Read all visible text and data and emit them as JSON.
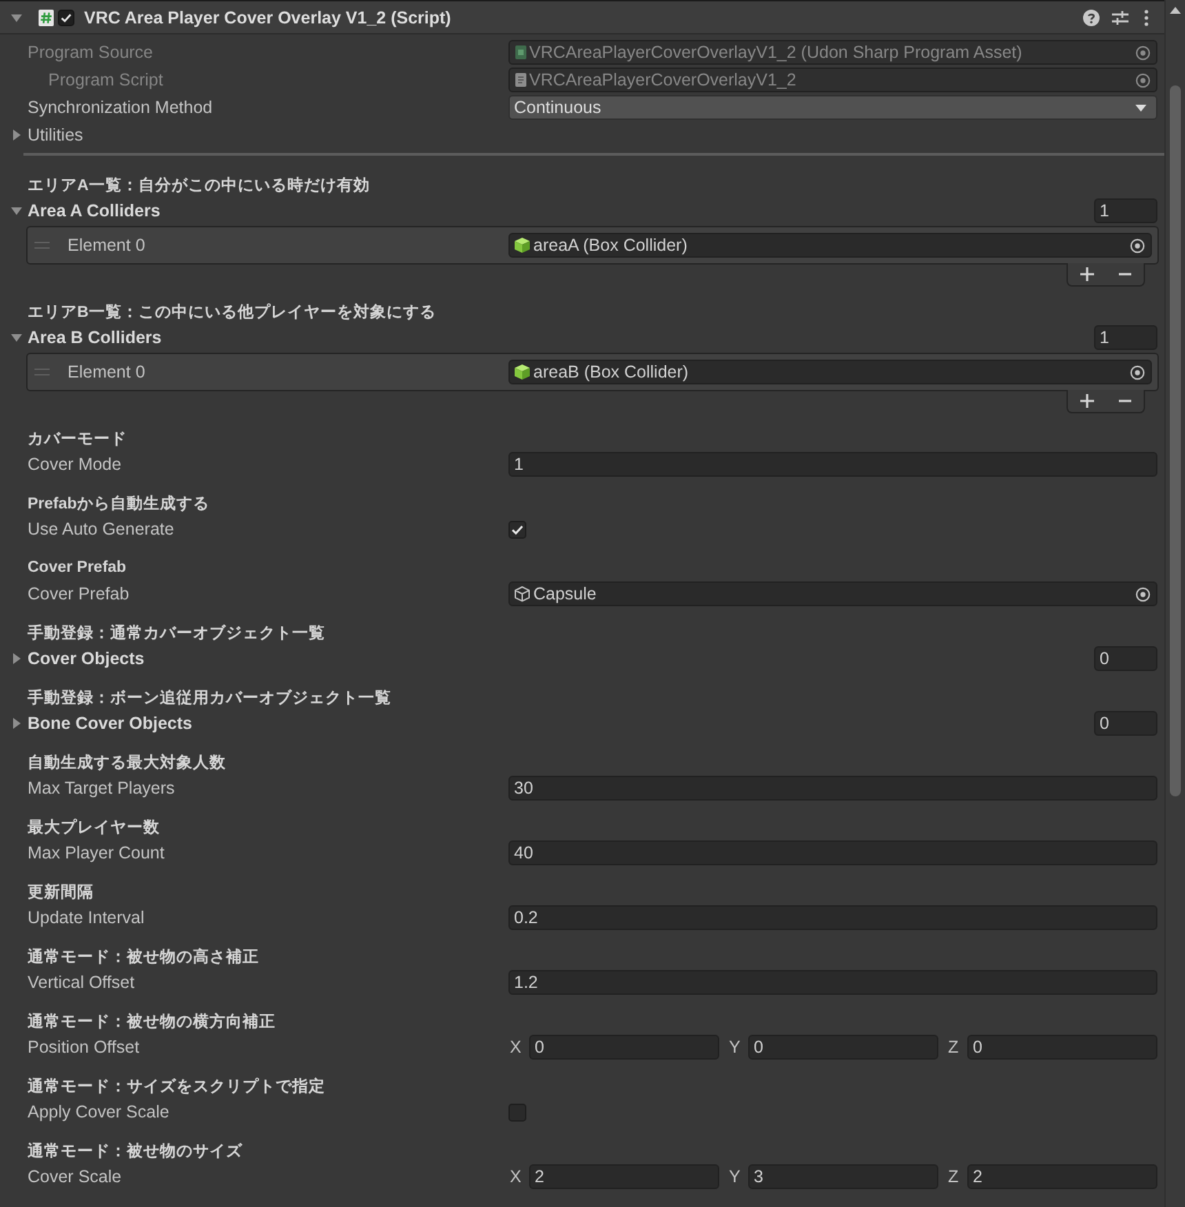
{
  "inspector": {
    "title": "VRC Area Player Cover Overlay V1_2 (Script)",
    "expanded": true,
    "enabled": true
  },
  "script_fields": [
    {
      "kind": "object",
      "label": "Program Source",
      "value": "VRCAreaPlayerCoverOverlayV1_2 (Udon Sharp Program Asset)",
      "disabled": true,
      "children": [
        {
          "kind": "object",
          "label": "Program Script",
          "value": "VRCAreaPlayerCoverOverlayV1_2",
          "disabled": true
        }
      ]
    },
    {
      "kind": "dropdown",
      "label": "Synchronization Method",
      "value": "Continuous",
      "disabled": false
    },
    {
      "kind": "foldout",
      "label": "Utilities",
      "expanded": false,
      "disabled": false
    }
  ],
  "sections": [
    {
      "header": "エリアA一覧：自分がこの中にいる時だけ有効",
      "field": {
        "kind": "list",
        "label": "Area A Colliders",
        "expanded": true,
        "size": "1",
        "elements": [
          {
            "label": "Element 0",
            "value": "areaA (Box Collider)"
          }
        ]
      }
    },
    {
      "header": "エリアB一覧：この中にいる他プレイヤーを対象にする",
      "field": {
        "kind": "list",
        "label": "Area B Colliders",
        "expanded": true,
        "size": "1",
        "elements": [
          {
            "label": "Element 0",
            "value": "areaB (Box Collider)"
          }
        ]
      }
    },
    {
      "header": "カバーモード",
      "field": {
        "kind": "number",
        "label": "Cover Mode",
        "value": "1"
      }
    },
    {
      "header": "Prefabから自動生成する",
      "field": {
        "kind": "toggle",
        "label": "Use Auto Generate",
        "checked": true
      }
    },
    {
      "header": "Cover Prefab",
      "field": {
        "kind": "object",
        "label": "Cover Prefab",
        "value": "Capsule"
      }
    },
    {
      "header": "手動登録：通常カバーオブジェクト一覧",
      "field": {
        "kind": "list",
        "label": "Cover Objects",
        "expanded": false,
        "size": "0"
      }
    },
    {
      "header": "手動登録：ボーン追従用カバーオブジェクト一覧",
      "field": {
        "kind": "list",
        "label": "Bone Cover Objects",
        "expanded": false,
        "size": "0"
      }
    },
    {
      "header": "自動生成する最大対象人数",
      "field": {
        "kind": "number",
        "label": "Max Target Players",
        "value": "30"
      }
    },
    {
      "header": "最大プレイヤー数",
      "field": {
        "kind": "number",
        "label": "Max Player Count",
        "value": "40"
      }
    },
    {
      "header": "更新間隔",
      "field": {
        "kind": "number",
        "label": "Update Interval",
        "value": "0.2"
      }
    },
    {
      "header": "通常モード：被せ物の高さ補正",
      "field": {
        "kind": "number",
        "label": "Vertical Offset",
        "value": "1.2"
      }
    },
    {
      "header": "通常モード：被せ物の横方向補正",
      "field": {
        "kind": "vector3",
        "label": "Position Offset",
        "components": [
          {
            "axis": "X",
            "value": "0"
          },
          {
            "axis": "Y",
            "value": "0"
          },
          {
            "axis": "Z",
            "value": "0"
          }
        ]
      }
    },
    {
      "header": "通常モード：サイズをスクリプトで指定",
      "field": {
        "kind": "toggle",
        "label": "Apply Cover Scale",
        "checked": false
      }
    },
    {
      "header": "通常モード：被せ物のサイズ",
      "field": {
        "kind": "vector3",
        "label": "Cover Scale",
        "components": [
          {
            "axis": "X",
            "value": "2"
          },
          {
            "axis": "Y",
            "value": "3"
          },
          {
            "axis": "Z",
            "value": "2"
          }
        ]
      }
    }
  ]
}
